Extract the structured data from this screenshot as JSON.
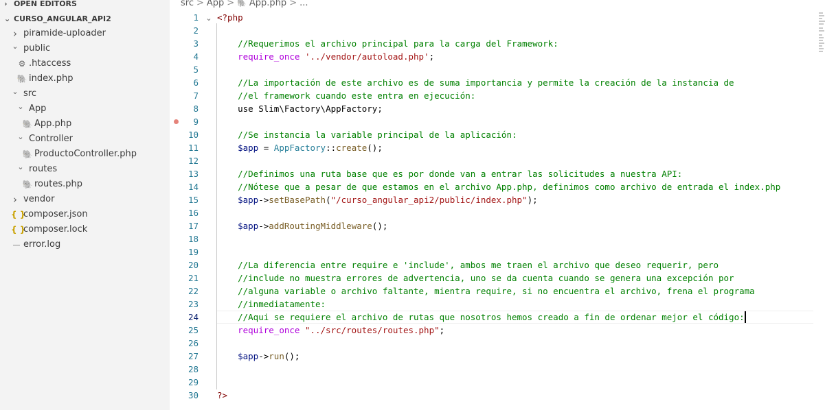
{
  "sidebar": {
    "open_editors_label": "OPEN EDITORS",
    "workspace_label": "CURSO_ANGULAR_API2",
    "items": [
      {
        "label": "piramide-uploader",
        "type": "folder",
        "expanded": false,
        "icon": "chevron-right-icon"
      },
      {
        "label": "public",
        "type": "folder",
        "expanded": true,
        "icon": "chevron-down-icon"
      },
      {
        "label": ".htaccess",
        "type": "file",
        "icon": "gear-icon"
      },
      {
        "label": "index.php",
        "type": "file",
        "icon": "php-icon"
      },
      {
        "label": "src",
        "type": "folder",
        "expanded": true,
        "icon": "chevron-down-icon"
      },
      {
        "label": "App",
        "type": "folder",
        "expanded": true,
        "icon": "chevron-down-icon"
      },
      {
        "label": "App.php",
        "type": "file",
        "icon": "php-icon"
      },
      {
        "label": "Controller",
        "type": "folder",
        "expanded": true,
        "icon": "chevron-down-icon"
      },
      {
        "label": "ProductoController.php",
        "type": "file",
        "icon": "php-icon"
      },
      {
        "label": "routes",
        "type": "folder",
        "expanded": true,
        "icon": "chevron-down-icon"
      },
      {
        "label": "routes.php",
        "type": "file",
        "icon": "php-icon"
      },
      {
        "label": "vendor",
        "type": "folder",
        "expanded": false,
        "icon": "chevron-right-icon"
      },
      {
        "label": "composer.json",
        "type": "file",
        "icon": "json-icon"
      },
      {
        "label": "composer.lock",
        "type": "file",
        "icon": "json-icon"
      },
      {
        "label": "error.log",
        "type": "file",
        "icon": "log-icon"
      }
    ]
  },
  "breadcrumb": {
    "parts": [
      "src",
      "App",
      "App.php",
      "..."
    ]
  },
  "editor": {
    "active_line": 24,
    "breakpoint_line": 9,
    "lines": [
      "<?php",
      "",
      "    //Requerimos el archivo principal para la carga del Framework:",
      "    require_once '../vendor/autoload.php';",
      "",
      "    //La importación de este archivo es de suma importancia y permite la creación de la instancia de",
      "    //el framework cuando este entra en ejecución:",
      "    use Slim\\Factory\\AppFactory;",
      "",
      "    //Se instancia la variable principal de la aplicación:",
      "    $app = AppFactory::create();",
      "",
      "    //Definimos una ruta base que es por donde van a entrar las solicitudes a nuestra API:",
      "    //Nótese que a pesar de que estamos en el archivo App.php, definimos como archivo de entrada el index.php",
      "    $app->setBasePath(\"/curso_angular_api2/public/index.php\");",
      "",
      "    $app->addRoutingMiddleware();",
      "",
      "",
      "    //La diferencia entre require e 'include', ambos me traen el archivo que deseo requerir, pero",
      "    //include no muestra errores de advertencia, uno se da cuenta cuando se genera una excepción por",
      "    //alguna variable o archivo faltante, mientra require, si no encuentra el archivo, frena el programa",
      "    //inmediatamente:",
      "    //Aqui se requiere el archivo de rutas que nosotros hemos creado a fin de ordenar mejor el código:",
      "    require_once \"../src/routes/routes.php\";",
      "",
      "    $app->run();",
      "",
      "",
      "?>"
    ]
  },
  "colors": {
    "comment": "#008000",
    "string": "#a31515",
    "keyword": "#0000ff",
    "line_number": "#237893",
    "breakpoint": "#e5837a",
    "sidebar_bg": "#f3f3f3"
  }
}
